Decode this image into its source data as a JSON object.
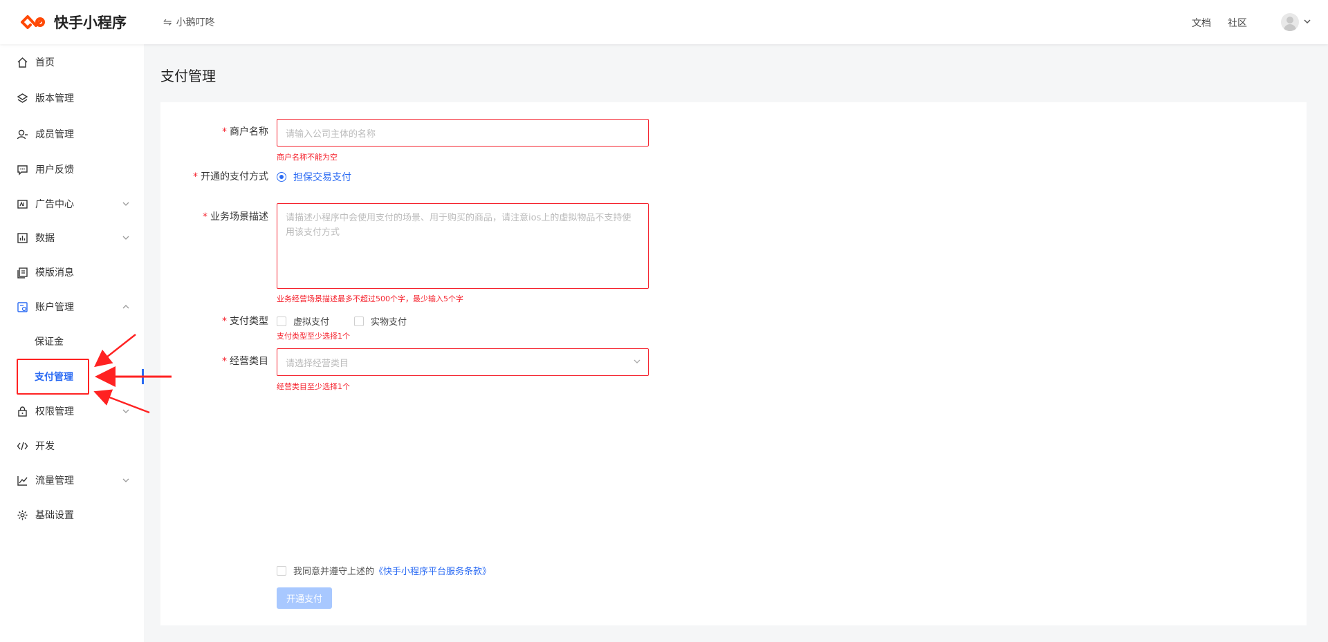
{
  "header": {
    "app_name": "快手小程序",
    "current_app": "小鹅叮咚",
    "docs": "文档",
    "community": "社区",
    "logo_color": "#ff4906"
  },
  "sidebar": {
    "items": [
      {
        "label": "首页",
        "icon": "home-icon"
      },
      {
        "label": "版本管理",
        "icon": "layers-icon"
      },
      {
        "label": "成员管理",
        "icon": "user-icon"
      },
      {
        "label": "用户反馈",
        "icon": "message-icon"
      },
      {
        "label": "广告中心",
        "icon": "ad-icon"
      },
      {
        "label": "数据",
        "icon": "chart-icon"
      },
      {
        "label": "模版消息",
        "icon": "template-icon"
      },
      {
        "label": "账户管理",
        "icon": "account-icon"
      },
      {
        "label": "保证金"
      },
      {
        "label": "支付管理"
      },
      {
        "label": "权限管理",
        "icon": "lock-icon"
      },
      {
        "label": "开发",
        "icon": "code-icon"
      },
      {
        "label": "流量管理",
        "icon": "trend-icon"
      },
      {
        "label": "基础设置",
        "icon": "gear-icon"
      }
    ],
    "active": "支付管理",
    "accent": "#2b6bf3"
  },
  "page": {
    "title": "支付管理"
  },
  "form": {
    "merchant_label": "商户名称",
    "merchant_placeholder": "请输入公司主体的名称",
    "merchant_error": "商户名称不能为空",
    "method_label": "开通的支付方式",
    "method_option": "担保交易支付",
    "desc_label": "业务场景描述",
    "desc_placeholder": "请描述小程序中会使用支付的场景、用于购买的商品，请注意ios上的虚拟物品不支持使用该支付方式",
    "desc_error": "业务经营场景描述最多不超过500个字，最少输入5个字",
    "type_label": "支付类型",
    "type_options": [
      "虚拟支付",
      "实物支付"
    ],
    "type_error": "支付类型至少选择1个",
    "category_label": "经营类目",
    "category_placeholder": "请选择经营类目",
    "category_error": "经营类目至少选择1个",
    "agree_text": "我同意并遵守上述的",
    "agree_link": "《快手小程序平台服务条款》",
    "submit": "开通支付",
    "error_color": "#f5222d"
  }
}
